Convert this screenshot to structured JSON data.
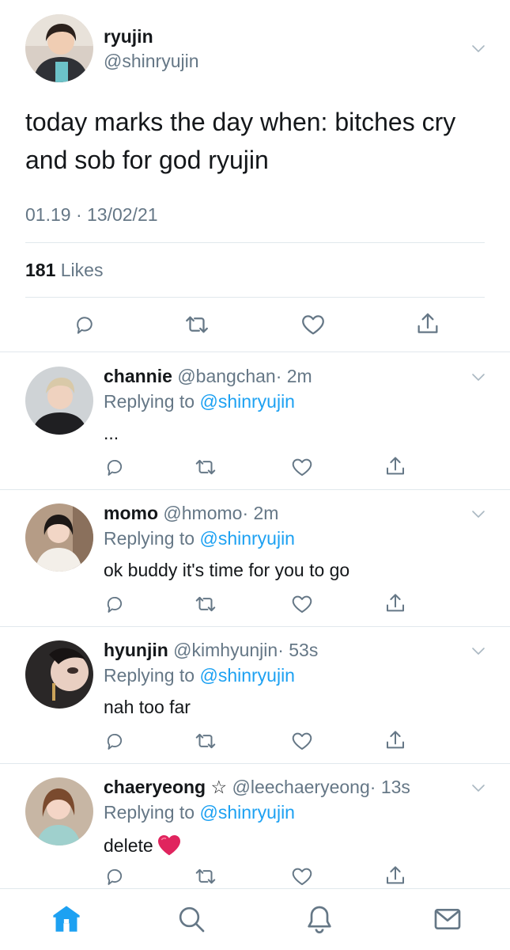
{
  "main_tweet": {
    "name": "ryujin",
    "handle": "@shinryujin",
    "text": "today marks the day when: bitches cry and sob for god ryujin",
    "timestamp": "01.19 · 13/02/21",
    "likes_count": "181",
    "likes_label": "Likes"
  },
  "replies": [
    {
      "name": "channie",
      "handle": "@bangchan",
      "time": "· 2m",
      "replying_label": "Replying to",
      "mention": "@shinryujin",
      "text": "..."
    },
    {
      "name": "momo",
      "handle": "@hmomo",
      "time": "· 2m",
      "replying_label": "Replying to",
      "mention": "@shinryujin",
      "text": "ok buddy it's time for you to go"
    },
    {
      "name": "hyunjin",
      "handle": "@kimhyunjin",
      "time": "· 53s",
      "replying_label": "Replying to",
      "mention": "@shinryujin",
      "text": "nah too far"
    },
    {
      "name": "chaeryeong ☆",
      "handle": "@leechaeryeong",
      "time": "· 13s",
      "replying_label": "Replying to",
      "mention": "@shinryujin",
      "text": "delete"
    }
  ],
  "icons": {
    "reply": "reply-icon",
    "retweet": "retweet-icon",
    "like": "heart-icon",
    "share": "share-icon",
    "more": "chevron-down-icon",
    "tabs": [
      "home-icon",
      "search-icon",
      "bell-icon",
      "mail-icon"
    ]
  },
  "colors": {
    "accent": "#1da1f2",
    "secondary_text": "#657786",
    "icon_gray": "#657786",
    "divider": "#e1e8ed",
    "heart_emoji": "#e0245e"
  }
}
